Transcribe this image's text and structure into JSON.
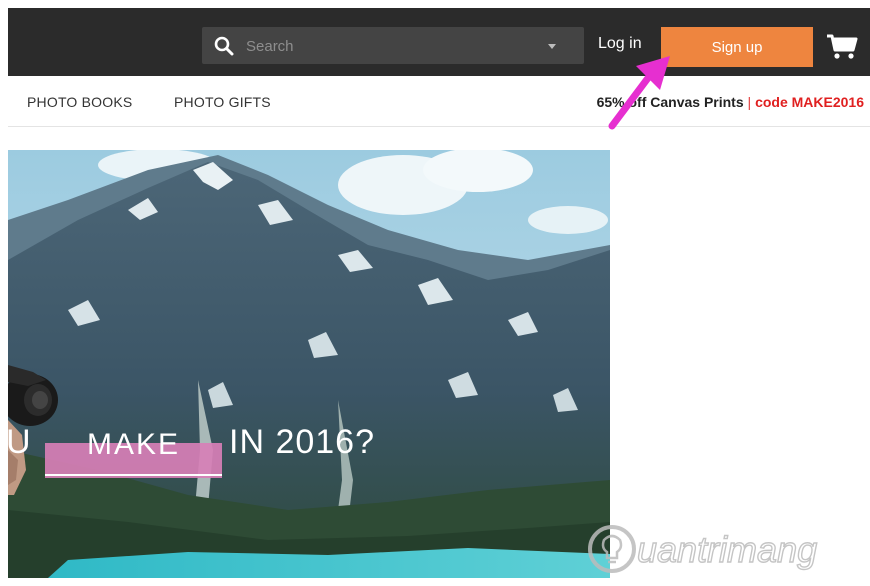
{
  "header": {
    "search": {
      "placeholder": "Search"
    },
    "login_label": "Log in",
    "signup_label": "Sign up"
  },
  "nav": {
    "items": [
      {
        "label": "PHOTO BOOKS"
      },
      {
        "label": "PHOTO GIFTS"
      }
    ],
    "promo": {
      "text": "65% off Canvas Prints",
      "separator": "|",
      "code": "code MAKE2016"
    }
  },
  "hero": {
    "headline_left": "U",
    "make_word": "MAKE",
    "headline_right": "IN 2016?"
  },
  "watermark": {
    "text": "uantrimang"
  },
  "colors": {
    "topbar": "#2b2b2b",
    "signup": "#ee853f",
    "promo_code": "#e02020",
    "make_highlight": "#d77fb6",
    "annotation_arrow": "#e62fd0"
  },
  "icons": {
    "search": "search-icon",
    "caret": "chevron-down-icon",
    "cart": "cart-icon",
    "arrow": "arrow-annotation-icon"
  }
}
